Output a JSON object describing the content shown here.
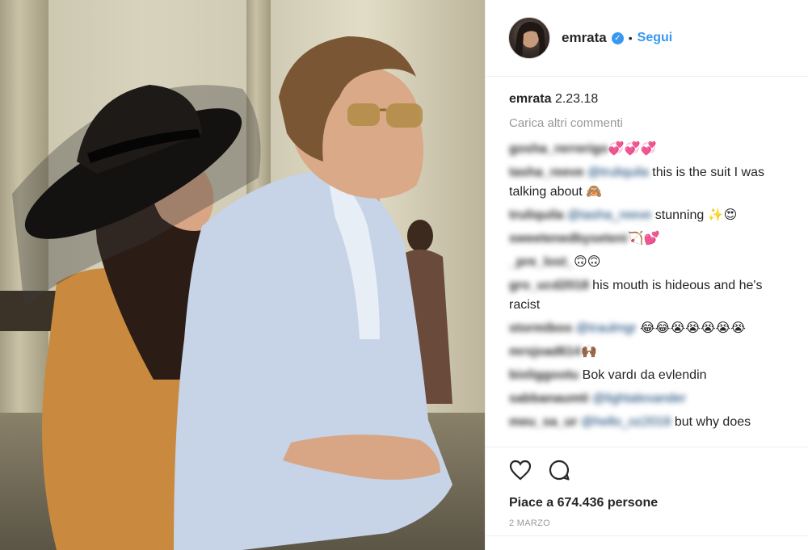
{
  "header": {
    "username": "emrata",
    "follow_label": "Segui"
  },
  "caption": {
    "username": "emrata",
    "text": "2.23.18"
  },
  "load_more_label": "Carica altri commenti",
  "comments": [
    {
      "user": "gosha_rerrerigo",
      "mention": "",
      "text": "💞💞💞"
    },
    {
      "user": "tasha_reeve",
      "mention": "@truliquila",
      "text": " this is the suit I was talking about 🙈"
    },
    {
      "user": "truliquila",
      "mention": "@tasha_reeve",
      "text": " stunning ✨😍"
    },
    {
      "user": "sweetenedbyseteni",
      "mention": "",
      "text": "🏹💕"
    },
    {
      "user": "_pre_lost_",
      "mention": "",
      "text": "🙃🙃"
    },
    {
      "user": "gro_ucd2018",
      "mention": "",
      "text": " his mouth is hideous and he's racist"
    },
    {
      "user": "stormiboo",
      "mention": "@traulmgr",
      "text": " 😂😂😭😭😭😭😭"
    },
    {
      "user": "mrsjoad614",
      "mention": "",
      "text": "🙌🏾"
    },
    {
      "user": "bixliggootu",
      "mention": "",
      "text": " Bok vardı da evlendin"
    },
    {
      "user": "sabbanaumti",
      "mention": "@lightalexander",
      "text": ""
    },
    {
      "user": "meu_sa_ur",
      "mention": "@hello_oz2018",
      "text": " but why does"
    }
  ],
  "actions": {
    "like_icon": "heart-icon",
    "comment_icon": "comment-bubble-icon",
    "likes_text": "Piace a 674.436 persone",
    "date": "2 MARZO"
  },
  "colors": {
    "link": "#3897f0",
    "mention": "#003569",
    "muted": "#999999",
    "text": "#262626"
  }
}
